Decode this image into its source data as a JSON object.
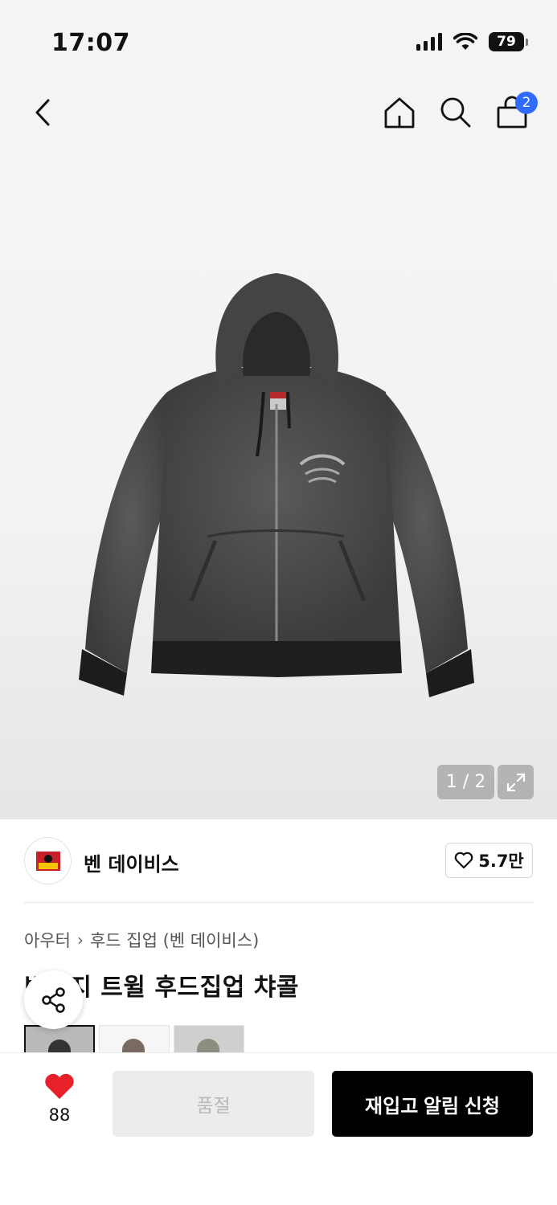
{
  "status_bar": {
    "time": "17:07",
    "battery": "79"
  },
  "header": {
    "cart_count": "2"
  },
  "gallery": {
    "pager": "1 / 2"
  },
  "brand": {
    "name": "벤 데이비스",
    "likes": "5.7만"
  },
  "breadcrumb": {
    "category": "아우터",
    "subcategory": "후드 집업 (벤 데이비스)"
  },
  "product": {
    "title": "빈티지 트윌 후드집업 챠콜"
  },
  "variants": [
    {
      "name": "charcoal",
      "color": "#3a3a3a"
    },
    {
      "name": "brown",
      "color": "#7a6a62"
    },
    {
      "name": "olive",
      "color": "#8b8e7e"
    }
  ],
  "bottom": {
    "like_count": "88",
    "soldout_label": "품절",
    "restock_label": "재입고 알림 신청"
  },
  "colors": {
    "accent_badge": "#2f6bff",
    "heart": "#e8202a"
  }
}
